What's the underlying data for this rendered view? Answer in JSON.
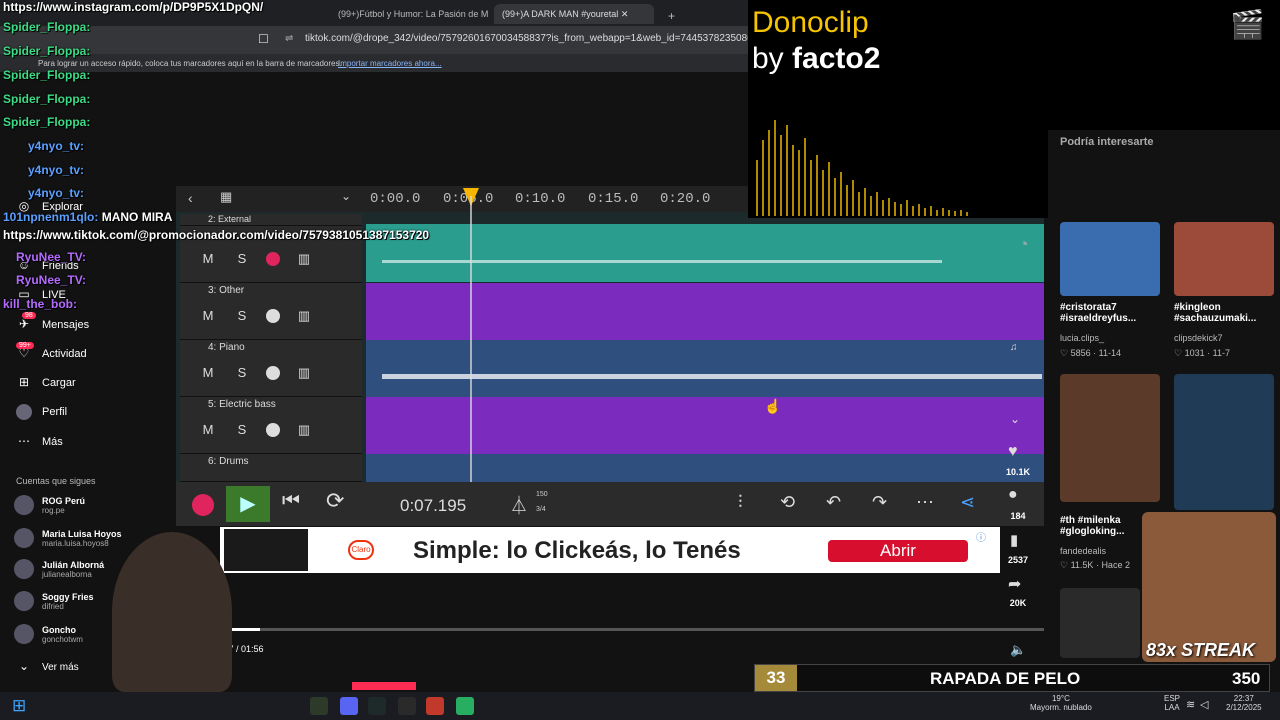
{
  "browser": {
    "tabs": [
      {
        "label": "(99+)Fútbol y Humor: La Pasión de M"
      },
      {
        "label": "(99+)A DARK MAN #youretal"
      }
    ],
    "url": "tiktok.com/@drope_342/video/7579260167003458837?is_from_webapp=1&web_id=744537823508647270",
    "bookmarks_hint": "Para lograr un acceso rápido, coloca tus marcadores aquí en la barra de marcadores.",
    "bookmarks_link": "Importar marcadores ahora..."
  },
  "overlay_url": "https://www.instagram.com/p/DP9P5X1DpQN/",
  "sidebar": {
    "items": [
      {
        "label": "Explorar",
        "icon": "compass-icon"
      },
      {
        "label": "Friends",
        "icon": "friends-icon"
      },
      {
        "label": "LIVE",
        "icon": "live-icon"
      },
      {
        "label": "Mensajes",
        "icon": "message-icon",
        "badge": "98"
      },
      {
        "label": "Actividad",
        "icon": "activity-icon",
        "badge": "99+"
      },
      {
        "label": "Cargar",
        "icon": "plus-icon"
      },
      {
        "label": "Perfil",
        "icon": "profile-icon"
      },
      {
        "label": "Más",
        "icon": "more-icon"
      }
    ],
    "following_title": "Cuentas que sigues",
    "following": [
      {
        "name": "ROG Perú",
        "handle": "rog.pe"
      },
      {
        "name": "Maria Luisa Hoyos",
        "handle": "maria.luisa.hoyos8"
      },
      {
        "name": "Julián Alborná",
        "handle": "julianealborna"
      },
      {
        "name": "Soggy Fries",
        "handle": "difried"
      },
      {
        "name": "Goncho",
        "handle": "gonchotwm"
      }
    ],
    "see_more": "Ver más"
  },
  "chat": [
    {
      "user": "Spider_Floppa:",
      "msg": ""
    },
    {
      "user": "Spider_Floppa:",
      "msg": ""
    },
    {
      "user": "Spider_Floppa:",
      "msg": ""
    },
    {
      "user": "Spider_Floppa:",
      "msg": ""
    },
    {
      "user": "Spider_Floppa:",
      "msg": ""
    },
    {
      "user": "y4nyo_tv:",
      "msg": ""
    },
    {
      "user": "y4nyo_tv:",
      "msg": ""
    },
    {
      "user": "y4nyo_tv:",
      "msg": ""
    },
    {
      "user": "101npnenm1qlo:",
      "msg": "MANO MIRA"
    },
    {
      "user": "",
      "msg": "https://www.tiktok.com/@promocionador.com/video/7579381051387153720"
    },
    {
      "user": "RyuNee_TV:",
      "msg": ""
    },
    {
      "user": "RyuNee_TV:",
      "msg": ""
    },
    {
      "user": "kill_the_bob:",
      "msg": ""
    }
  ],
  "daw": {
    "time_marks": [
      "0:00.0",
      "0:05.0",
      "0:10.0",
      "0:15.0",
      "0:20.0"
    ],
    "tracks": [
      {
        "name": "2: External",
        "color": "#2a9d8f"
      },
      {
        "name": "3: Other",
        "color": "#7b2cbf"
      },
      {
        "name": "4: Piano",
        "color": "#2f4f7f"
      },
      {
        "name": "5: Electric bass",
        "color": "#7b2cbf"
      },
      {
        "name": "6: Drums",
        "color": "#2f4f7f"
      }
    ],
    "mute_label": "M",
    "solo_label": "S",
    "current_time": "0:07.195",
    "tempo": "150",
    "meter": "3/4"
  },
  "video": {
    "progress_time": "00:07 / 01:56",
    "progress_fraction": 0.06
  },
  "ad": {
    "brand": "Claro",
    "text": "Simple: lo Clickeás, lo Tenés",
    "button": "Abrir"
  },
  "side_actions": [
    {
      "icon": "heart-icon",
      "count": "10.1K"
    },
    {
      "icon": "comment-icon",
      "count": "184"
    },
    {
      "icon": "bookmark-icon",
      "count": "2537"
    },
    {
      "icon": "share-icon",
      "count": "20K"
    }
  ],
  "donoclip": {
    "title": "Donoclip",
    "by": "by",
    "user": "facto2"
  },
  "recommendations": {
    "title": "Podría interesarte",
    "items": [
      {
        "title": "#cristorata7 #israeldreyfus...",
        "user": "lucia.clips_",
        "likes": "5856",
        "date": "11-14"
      },
      {
        "title": "#kingleon #sachauzumaki...",
        "user": "clipsdekick7",
        "likes": "1031",
        "date": "11-7"
      },
      {
        "title": "#th #milenka #glogloking...",
        "user": "fandedealis",
        "likes": "11.5K",
        "date": "Hace 2"
      }
    ]
  },
  "streak": {
    "count": "33",
    "label": "RAPADA DE PELO",
    "right": "350",
    "overlay": "83x STREAK"
  },
  "taskbar": {
    "weather_temp": "19°C",
    "weather_desc": "Mayorm. nublado",
    "lang": "ESP",
    "lang2": "LAA",
    "time": "22:37",
    "date": "2/12/2025"
  },
  "colors": {
    "accent_green": "#3ddc84",
    "tiktok_red": "#fe2c55",
    "dono_yellow": "#f7c400",
    "ad_red": "#d70e2e"
  }
}
